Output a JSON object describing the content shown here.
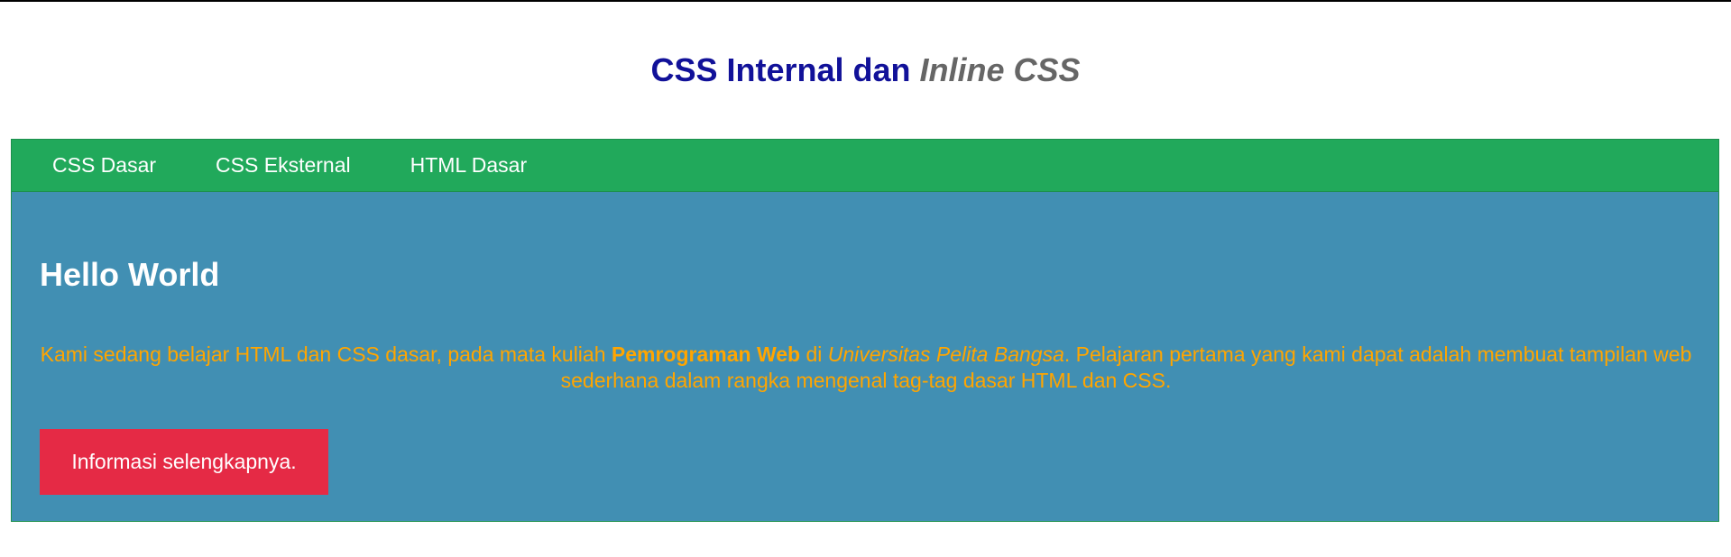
{
  "header": {
    "title_main": "CSS Internal dan ",
    "title_italic": "Inline CSS"
  },
  "nav": {
    "items": [
      {
        "label": "CSS Dasar"
      },
      {
        "label": "CSS Eksternal"
      },
      {
        "label": "HTML Dasar"
      }
    ]
  },
  "main": {
    "heading": "Hello World",
    "paragraph": {
      "part1": "Kami sedang belajar HTML dan CSS dasar, pada mata kuliah ",
      "bold": "Pemrograman Web",
      "part2": " di ",
      "italic": "Universitas Pelita Bangsa",
      "part3": ". Pelajaran pertama yang kami dapat adalah membuat tampilan web sederhana dalam rangka mengenal tag-tag dasar HTML dan CSS."
    },
    "button_label": "Informasi selengkapnya."
  },
  "colors": {
    "header_title": "#111199",
    "header_italic": "#666666",
    "navbar_bg": "#21a95b",
    "content_bg": "#418fb3",
    "paragraph_text": "#ffa500",
    "button_bg": "#e52a45"
  }
}
